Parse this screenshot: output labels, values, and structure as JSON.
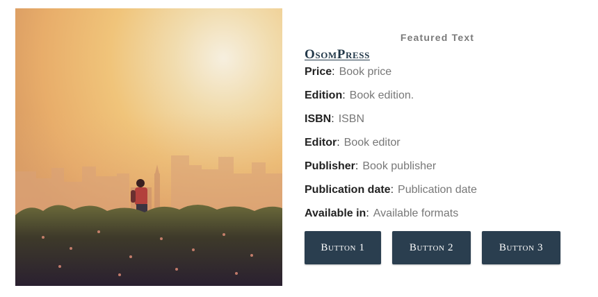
{
  "image": {
    "alt_icon": "cover-photo-icon"
  },
  "featured_label": "Featured Text",
  "title": "OsomPress",
  "details": [
    {
      "label": "Price",
      "value": "Book price"
    },
    {
      "label": "Edition",
      "value": "Book edition."
    },
    {
      "label": "ISBN",
      "value": "ISBN"
    },
    {
      "label": "Editor",
      "value": "Book editor"
    },
    {
      "label": "Publisher",
      "value": "Book publisher"
    },
    {
      "label": "Publication date",
      "value": "Publication date"
    },
    {
      "label": "Available in",
      "value": "Available formats"
    }
  ],
  "buttons": [
    {
      "label": "Button 1"
    },
    {
      "label": "Button 2"
    },
    {
      "label": "Button 3"
    }
  ],
  "colors": {
    "title": "#23394a",
    "button_bg": "#2a3e4f",
    "label_text": "#222222",
    "value_text": "#777777"
  }
}
